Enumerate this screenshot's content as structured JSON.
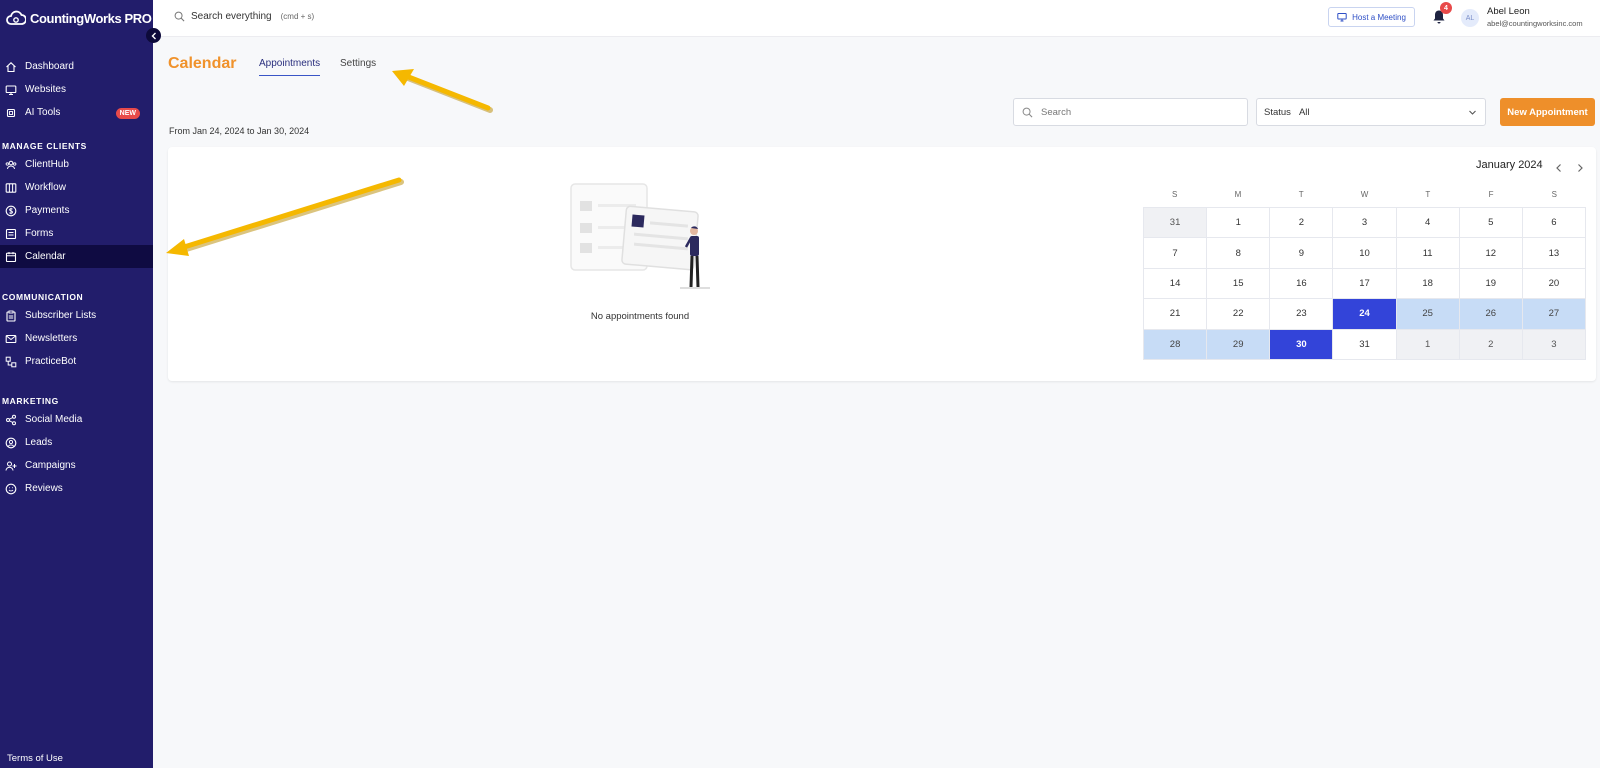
{
  "app": {
    "name": "CountingWorks PRO"
  },
  "colors": {
    "sidebar": "#221d6b",
    "accent_orange": "#ee8f2a",
    "title_orange": "#f0922b",
    "selected_day": "#3344d9",
    "range_day": "#c7dcf6",
    "annotation_arrow": "#f5b800"
  },
  "sidebar": {
    "items_top": [
      {
        "label": "Dashboard",
        "icon": "home-icon"
      },
      {
        "label": "Websites",
        "icon": "monitor-icon"
      },
      {
        "label": "AI Tools",
        "icon": "chip-icon",
        "badge": "NEW"
      }
    ],
    "manage_clients": {
      "title": "MANAGE CLIENTS",
      "items": [
        {
          "label": "ClientHub",
          "icon": "users-icon"
        },
        {
          "label": "Workflow",
          "icon": "columns-icon"
        },
        {
          "label": "Payments",
          "icon": "dollar-icon"
        },
        {
          "label": "Forms",
          "icon": "form-icon"
        },
        {
          "label": "Calendar",
          "icon": "calendar-icon",
          "active": true
        }
      ]
    },
    "communication": {
      "title": "COMMUNICATION",
      "items": [
        {
          "label": "Subscriber Lists",
          "icon": "clipboard-icon"
        },
        {
          "label": "Newsletters",
          "icon": "mail-icon"
        },
        {
          "label": "PracticeBot",
          "icon": "bot-icon"
        }
      ]
    },
    "marketing": {
      "title": "MARKETING",
      "items": [
        {
          "label": "Social Media",
          "icon": "share-icon"
        },
        {
          "label": "Leads",
          "icon": "user-circle-icon"
        },
        {
          "label": "Campaigns",
          "icon": "user-plus-icon"
        },
        {
          "label": "Reviews",
          "icon": "smile-icon"
        }
      ]
    },
    "terms": "Terms of Use"
  },
  "topbar": {
    "search_label": "Search everything",
    "search_hint": "(cmd + s)",
    "host_meeting": "Host a Meeting",
    "notification_count": "4",
    "avatar_initials": "AL",
    "user_name": "Abel Leon",
    "user_email": "abel@countingworksinc.com"
  },
  "page": {
    "title": "Calendar",
    "tabs": [
      "Appointments",
      "Settings"
    ],
    "active_tab": "Appointments",
    "range": "From Jan 24, 2024 to Jan 30, 2024",
    "search_placeholder": "Search",
    "status_label": "Status",
    "status_value": "All",
    "new_button": "New Appointment",
    "empty_message": "No appointments found"
  },
  "calendar": {
    "month": "January 2024",
    "weekdays": [
      "S",
      "M",
      "T",
      "W",
      "T",
      "F",
      "S"
    ],
    "weeks": [
      [
        {
          "d": "31",
          "s": "outside"
        },
        {
          "d": "1"
        },
        {
          "d": "2"
        },
        {
          "d": "3"
        },
        {
          "d": "4"
        },
        {
          "d": "5"
        },
        {
          "d": "6"
        }
      ],
      [
        {
          "d": "7"
        },
        {
          "d": "8"
        },
        {
          "d": "9"
        },
        {
          "d": "10"
        },
        {
          "d": "11"
        },
        {
          "d": "12"
        },
        {
          "d": "13"
        }
      ],
      [
        {
          "d": "14"
        },
        {
          "d": "15"
        },
        {
          "d": "16"
        },
        {
          "d": "17"
        },
        {
          "d": "18"
        },
        {
          "d": "19"
        },
        {
          "d": "20"
        }
      ],
      [
        {
          "d": "21"
        },
        {
          "d": "22"
        },
        {
          "d": "23"
        },
        {
          "d": "24",
          "s": "selected"
        },
        {
          "d": "25",
          "s": "in-range"
        },
        {
          "d": "26",
          "s": "in-range"
        },
        {
          "d": "27",
          "s": "in-range"
        }
      ],
      [
        {
          "d": "28",
          "s": "in-range"
        },
        {
          "d": "29",
          "s": "in-range"
        },
        {
          "d": "30",
          "s": "selected"
        },
        {
          "d": "31"
        },
        {
          "d": "1",
          "s": "outside"
        },
        {
          "d": "2",
          "s": "outside"
        },
        {
          "d": "3",
          "s": "outside"
        }
      ]
    ]
  }
}
